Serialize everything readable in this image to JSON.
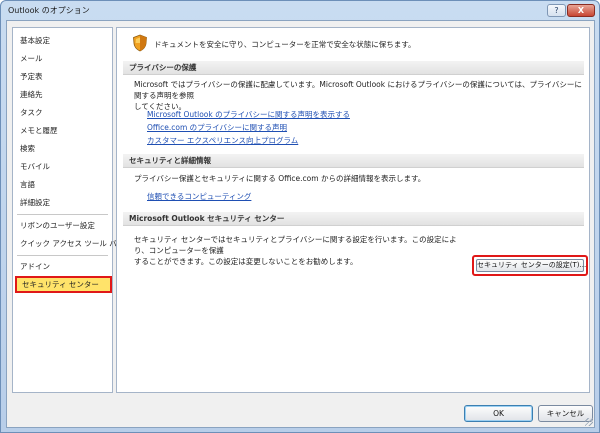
{
  "window": {
    "title": "Outlook のオプション",
    "help_label": "?",
    "close_label": "X"
  },
  "nav": {
    "items": [
      {
        "label": "基本設定"
      },
      {
        "label": "メール"
      },
      {
        "label": "予定表"
      },
      {
        "label": "連絡先"
      },
      {
        "label": "タスク"
      },
      {
        "label": "メモと履歴"
      },
      {
        "label": "検索"
      },
      {
        "label": "モバイル"
      },
      {
        "label": "言語"
      },
      {
        "label": "詳細設定"
      },
      {
        "label": "リボンのユーザー設定"
      },
      {
        "label": "クイック アクセス ツール バー"
      },
      {
        "label": "アドイン"
      },
      {
        "label": "セキュリティ センター"
      }
    ],
    "selected": "セキュリティ センター"
  },
  "main": {
    "intro": "ドキュメントを安全に守り、コンピューターを正常で安全な状態に保ちます。",
    "privacy": {
      "header": "プライバシーの保護",
      "text_line1": "Microsoft ではプライバシーの保護に配慮しています。Microsoft Outlook におけるプライバシーの保護については、プライバシーに関する声明を参照",
      "text_line2": "してください。",
      "links": [
        "Microsoft Outlook のプライバシーに関する声明を表示する",
        "Office.com のプライバシーに関する声明",
        "カスタマー エクスペリエンス向上プログラム"
      ]
    },
    "security": {
      "header": "セキュリティと詳細情報",
      "text": "プライバシー保護とセキュリティに関する Office.com からの詳細情報を表示します。",
      "link": "信頼できるコンピューティング"
    },
    "trust_center": {
      "header": "Microsoft Outlook セキュリティ センター",
      "text_line1": "セキュリティ センターではセキュリティとプライバシーに関する設定を行います。この設定により、コンピューターを保護",
      "text_line2": "することができます。この設定は変更しないことをお勧めします。",
      "button_label": "セキュリティ センターの設定(T)..."
    }
  },
  "footer": {
    "ok_label": "OK",
    "cancel_label": "キャンセル"
  },
  "colors": {
    "accent_highlight": "#e01818",
    "selected_bg": "#ffe36a",
    "link": "#1f4fb3"
  }
}
